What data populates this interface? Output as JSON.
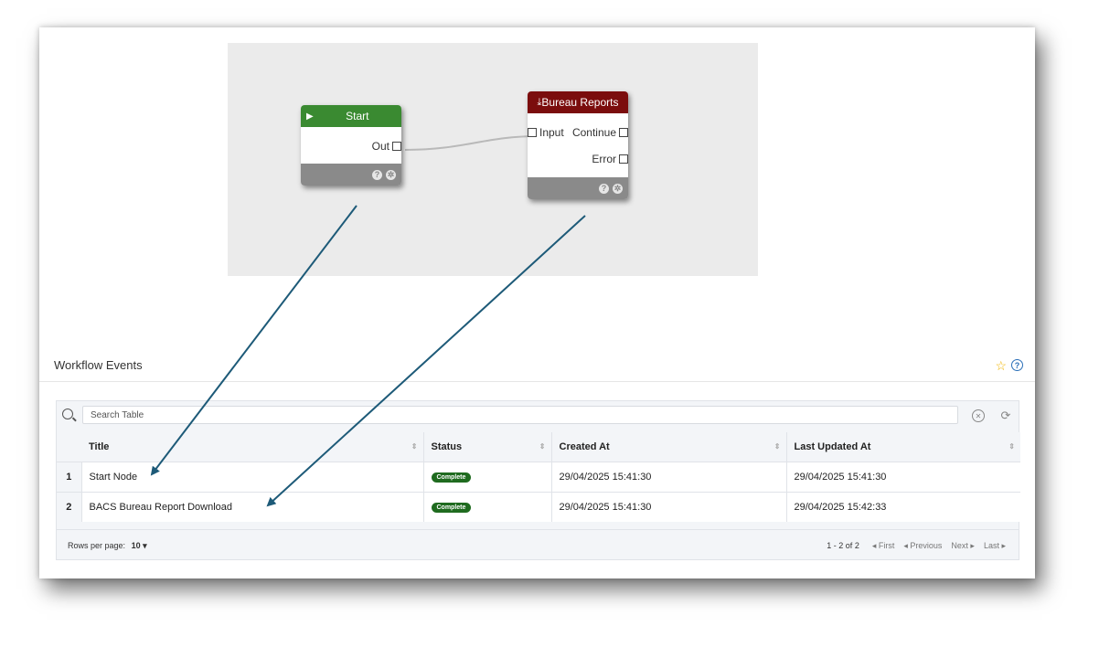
{
  "workflow": {
    "start_node": {
      "title": "Start",
      "out_port": "Out"
    },
    "bureau_node": {
      "title": "Bureau Reports",
      "input_port": "Input",
      "continue_port": "Continue",
      "error_port": "Error"
    },
    "node_footer_help": "?",
    "node_footer_gear": "✲"
  },
  "events": {
    "section_title": "Workflow Events",
    "search_placeholder": "Search Table",
    "columns": [
      "Title",
      "Status",
      "Created At",
      "Last Updated At"
    ],
    "rows": [
      {
        "num": "1",
        "title": "Start Node",
        "status": "Complete",
        "created": "29/04/2025 15:41:30",
        "updated": "29/04/2025 15:41:30"
      },
      {
        "num": "2",
        "title": "BACS Bureau Report Download",
        "status": "Complete",
        "created": "29/04/2025 15:41:30",
        "updated": "29/04/2025 15:42:33"
      }
    ],
    "rows_per_page_label": "Rows per page:",
    "rows_per_page_value": "10",
    "page_range": "1 - 2 of 2",
    "first": "First",
    "previous": "Previous",
    "next": "Next",
    "last": "Last"
  },
  "colors": {
    "start_header": "#3a8a31",
    "bureau_header": "#7b0d0d",
    "badge": "#1f6b1f",
    "arrow": "#1d5a78"
  }
}
